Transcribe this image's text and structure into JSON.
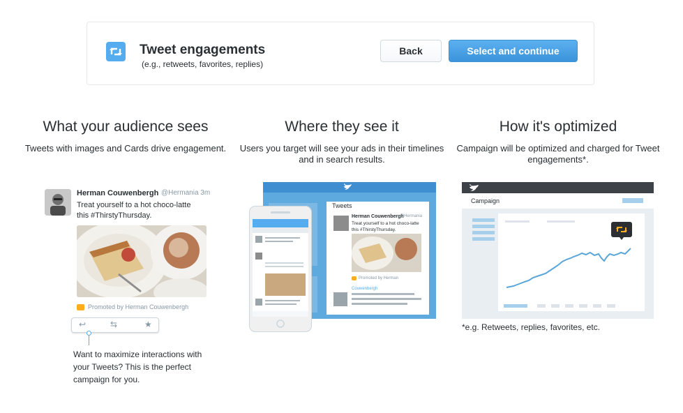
{
  "header": {
    "title": "Tweet engagements",
    "subtitle": "(e.g., retweets, favorites, replies)",
    "back_label": "Back",
    "continue_label": "Select and continue",
    "icon": "retweet-icon"
  },
  "columns": [
    {
      "title": "What your audience sees",
      "description": "Tweets with images and Cards drive engagement."
    },
    {
      "title": "Where they see it",
      "description": "Users you target will see your ads in their timelines and in search results."
    },
    {
      "title": "How it's optimized",
      "description": "Campaign will be optimized and charged for Tweet engagements*."
    }
  ],
  "tweet": {
    "name": "Herman Couwenbergh",
    "handle": "@Hermania",
    "time": "3m",
    "text": "Treat yourself to a hot choco-latte this #ThirstyThursday.",
    "promoted": "Promoted by Herman Couwenbergh"
  },
  "callout": "Want to maximize interactions with your Tweets? This is the perfect campaign for you.",
  "device_preview": {
    "timeline_label": "Tweets",
    "name": "Herman Couwenbergh",
    "handle": "@Hermania",
    "text": "Treat yourself to a hot choco-latte this #ThirstyThursday.",
    "promoted": "Promoted by Herman",
    "suggestion_name": "Couwenbergh"
  },
  "analytics": {
    "label": "Campaign",
    "footnote": "*e.g. Retweets, replies, favorites, etc."
  },
  "colors": {
    "accent": "#55acee",
    "button_blue": "#3b94d9",
    "promoted": "#ffad1f",
    "chart_line": "#5aa6d8"
  }
}
